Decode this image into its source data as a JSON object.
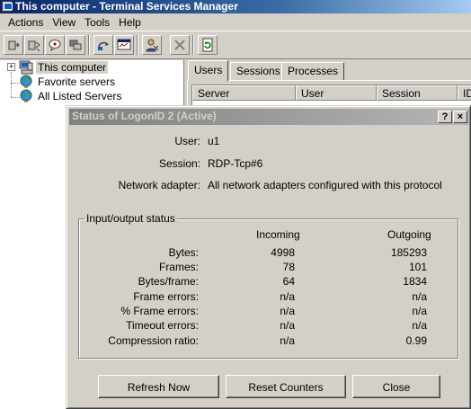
{
  "window": {
    "title": "This computer - Terminal Services Manager"
  },
  "menu": {
    "items": [
      "Actions",
      "View",
      "Tools",
      "Help"
    ]
  },
  "toolbar": {
    "buttons": [
      "connect-icon",
      "disconnect-icon",
      "send-message-icon",
      "remote-control-icon",
      "reset-icon",
      "status-icon",
      "logoff-icon",
      "end-process-icon",
      "refresh-icon"
    ]
  },
  "tree": {
    "items": [
      {
        "label": "This computer",
        "icon": "computer-icon",
        "selected": true
      },
      {
        "label": "Favorite servers",
        "icon": "favorites-globe-icon"
      },
      {
        "label": "All Listed Servers",
        "icon": "globe-icon"
      }
    ]
  },
  "tabs": [
    "Users",
    "Sessions",
    "Processes"
  ],
  "list": {
    "columns": [
      "Server",
      "User",
      "Session",
      "ID"
    ]
  },
  "dialog": {
    "title": "Status of LogonID 2  (Active)",
    "caption_help": "?",
    "caption_close": "×",
    "user_label": "User:",
    "user_value": "u1",
    "session_label": "Session:",
    "session_value": "RDP-Tcp#6",
    "adapter_label": "Network adapter:",
    "adapter_value": "All network adapters configured with this protocol",
    "io": {
      "title": "Input/output status",
      "incoming_header": "Incoming",
      "outgoing_header": "Outgoing",
      "rows": [
        {
          "label": "Bytes:",
          "incoming": "4998",
          "outgoing": "185293"
        },
        {
          "label": "Frames:",
          "incoming": "78",
          "outgoing": "101"
        },
        {
          "label": "Bytes/frame:",
          "incoming": "64",
          "outgoing": "1834"
        },
        {
          "label": "Frame errors:",
          "incoming": "n/a",
          "outgoing": "n/a"
        },
        {
          "label": "% Frame errors:",
          "incoming": "n/a",
          "outgoing": "n/a"
        },
        {
          "label": "Timeout errors:",
          "incoming": "n/a",
          "outgoing": "n/a"
        },
        {
          "label": "Compression ratio:",
          "incoming": "n/a",
          "outgoing": "0.99"
        }
      ]
    },
    "buttons": {
      "refresh": "Refresh Now",
      "reset": "Reset Counters",
      "close": "Close"
    }
  }
}
